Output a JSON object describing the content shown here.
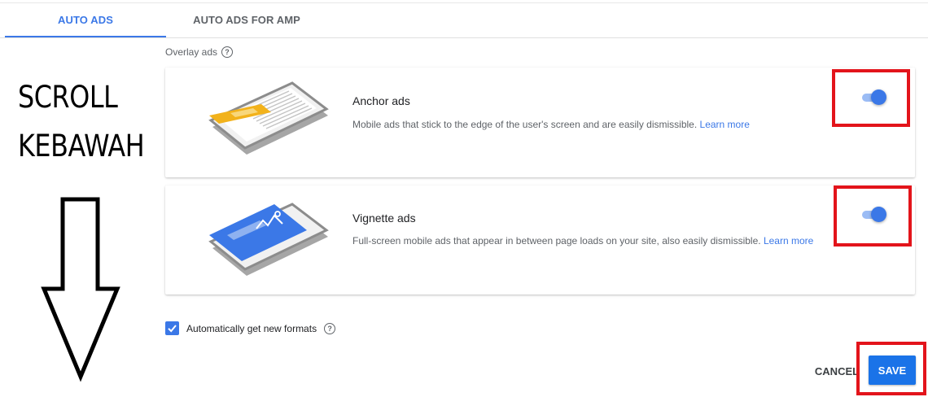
{
  "tabs": [
    {
      "label": "AUTO ADS",
      "active": true
    },
    {
      "label": "AUTO ADS FOR AMP",
      "active": false
    }
  ],
  "section": {
    "label": "Overlay ads",
    "help_icon": "help-circle-icon"
  },
  "formats": [
    {
      "title": "Anchor ads",
      "description": "Mobile ads that stick to the edge of the user's screen and are easily dismissible.",
      "link": "Learn more",
      "enabled": true,
      "illustration": "phone-anchor-ad-illustration"
    },
    {
      "title": "Vignette ads",
      "description": "Full-screen mobile ads that appear in between page loads on your site, also easily dismissible.",
      "link": "Learn more",
      "enabled": true,
      "illustration": "phone-vignette-ad-illustration"
    }
  ],
  "auto_formats": {
    "label": "Automatically get new formats",
    "checked": true
  },
  "actions": {
    "cancel": "CANCEL",
    "save": "SAVE"
  },
  "annotation": {
    "line1": "SCROLL",
    "line2": "KEBAWAH",
    "arrow": "down-arrow-icon"
  },
  "colors": {
    "accent": "#3b78e7",
    "highlight_box": "#e3141b",
    "save_button": "#1a73e8"
  }
}
